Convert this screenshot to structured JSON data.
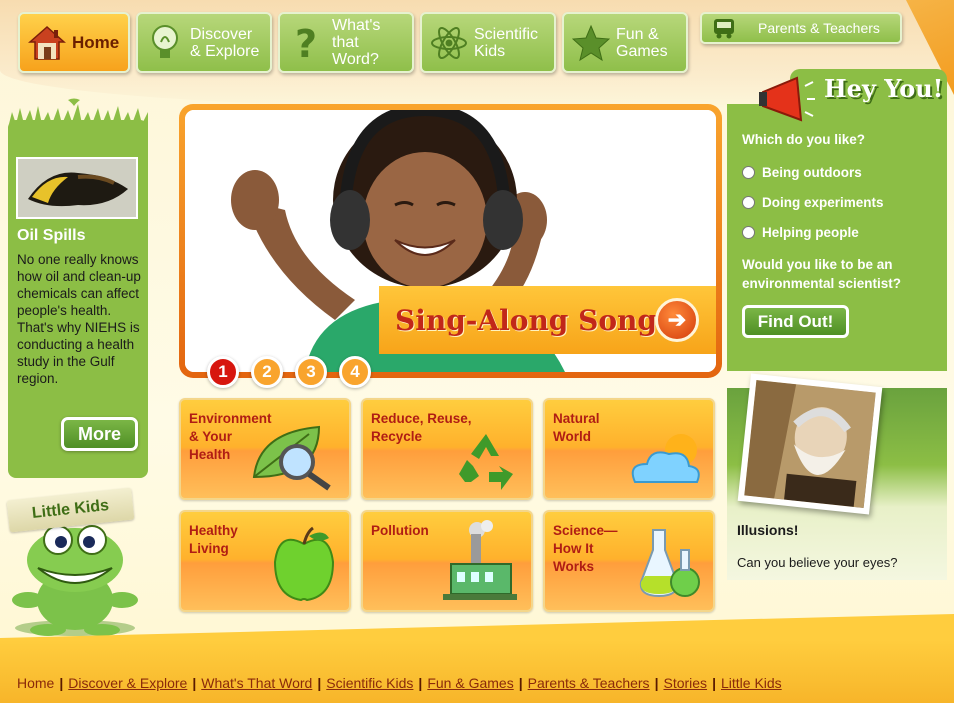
{
  "nav": {
    "home": "Home",
    "items": [
      {
        "label": "Discover\n& Explore",
        "icon": "lightbulb-icon"
      },
      {
        "label": "What's\nthat Word?",
        "icon": "question-mark-icon"
      },
      {
        "label": "Scientific\nKids",
        "icon": "atom-icon"
      },
      {
        "label": "Fun &\nGames",
        "icon": "star-icon"
      }
    ],
    "parents": "Parents & Teachers"
  },
  "left": {
    "oil_title": "Oil Spills",
    "oil_text": "No one really knows how oil and clean-up chemicals can affect people's health. That's why NIEHS is conducting a health study in the Gulf region.",
    "more": "More",
    "little_kids": "Little Kids"
  },
  "hero": {
    "title": "Sing-Along Songs",
    "dots": [
      "1",
      "2",
      "3",
      "4"
    ],
    "active_dot": 1
  },
  "tiles": [
    {
      "label": "Environment\n& Your\nHealth",
      "icon": "leaf-magnifier-icon"
    },
    {
      "label": "Reduce, Reuse,\nRecycle",
      "icon": "recycle-icon"
    },
    {
      "label": "Natural\nWorld",
      "icon": "cloud-sun-icon"
    },
    {
      "label": "Healthy\nLiving",
      "icon": "apple-icon"
    },
    {
      "label": "Pollution",
      "icon": "factory-icon"
    },
    {
      "label": "Science—\nHow It\nWorks",
      "icon": "flask-icon"
    }
  ],
  "hey": {
    "title": "Hey You!",
    "question": "Which do you like?",
    "options": [
      "Being outdoors",
      "Doing experiments",
      "Helping people"
    ],
    "question2": "Would you like to be an environmental scientist?",
    "button": "Find Out!"
  },
  "illusions": {
    "title": "Illusions!",
    "text": "Can you believe your eyes?"
  },
  "footer": {
    "links": [
      "Home",
      "Discover & Explore",
      "What's That Word",
      "Scientific Kids",
      "Fun & Games",
      "Parents & Teachers",
      "Stories",
      "Little Kids"
    ]
  },
  "colors": {
    "green": "#8cbe45",
    "orange": "#ffb12c",
    "red": "#b01d14",
    "cream": "#fdf6d8"
  }
}
